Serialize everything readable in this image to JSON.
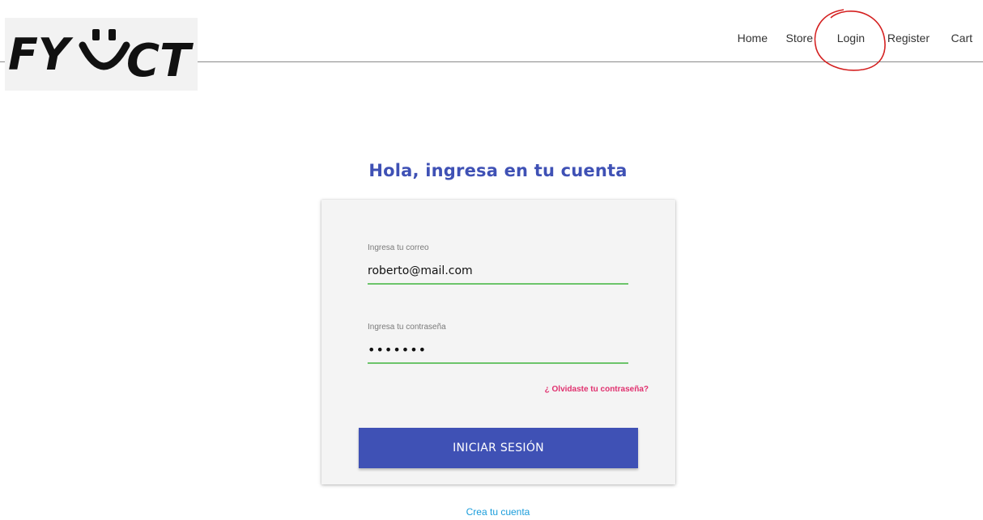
{
  "logo": {
    "text_left": "FY",
    "text_right": "CT"
  },
  "nav": {
    "items": [
      {
        "label": "Home"
      },
      {
        "label": "Store"
      },
      {
        "label": "Login"
      },
      {
        "label": "Register"
      },
      {
        "label": "Cart"
      }
    ]
  },
  "login": {
    "title": "Hola, ingresa en tu cuenta",
    "email_label": "Ingresa tu correo",
    "email_value": "roberto@mail.com",
    "password_label": "Ingresa tu contraseña",
    "password_value": "•••••••",
    "forgot_link": "¿ Olvidaste tu contraseña?",
    "submit_label": "INICIAR SESIÓN",
    "create_account_link": "Crea tu cuenta"
  },
  "colors": {
    "primary": "#3f51b5",
    "input_underline": "#6cc46a",
    "forgot_link": "#e0306e",
    "create_link": "#1a9ddb",
    "annotation": "#d42020"
  }
}
